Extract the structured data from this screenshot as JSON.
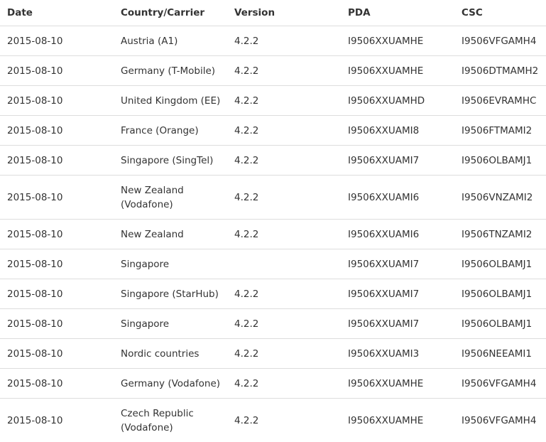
{
  "table": {
    "headers": {
      "date": "Date",
      "country": "Country/Carrier",
      "version": "Version",
      "pda": "PDA",
      "csc": "CSC"
    },
    "rows": [
      {
        "date": "2015-08-10",
        "country": "Austria (A1)",
        "version": "4.2.2",
        "pda": "I9506XXUAMHE",
        "csc": "I9506VFGAMH4"
      },
      {
        "date": "2015-08-10",
        "country": "Germany (T-Mobile)",
        "version": "4.2.2",
        "pda": "I9506XXUAMHE",
        "csc": "I9506DTMAMH2"
      },
      {
        "date": "2015-08-10",
        "country": "United Kingdom (EE)",
        "version": "4.2.2",
        "pda": "I9506XXUAMHD",
        "csc": "I9506EVRAMHC"
      },
      {
        "date": "2015-08-10",
        "country": "France (Orange)",
        "version": "4.2.2",
        "pda": "I9506XXUAMI8",
        "csc": "I9506FTMAMI2"
      },
      {
        "date": "2015-08-10",
        "country": "Singapore (SingTel)",
        "version": "4.2.2",
        "pda": "I9506XXUAMI7",
        "csc": "I9506OLBAMJ1"
      },
      {
        "date": "2015-08-10",
        "country": "New Zealand (Vodafone)",
        "version": "4.2.2",
        "pda": "I9506XXUAMI6",
        "csc": "I9506VNZAMI2"
      },
      {
        "date": "2015-08-10",
        "country": "New Zealand",
        "version": "4.2.2",
        "pda": "I9506XXUAMI6",
        "csc": "I9506TNZAMI2"
      },
      {
        "date": "2015-08-10",
        "country": "Singapore",
        "version": "",
        "pda": "I9506XXUAMI7",
        "csc": "I9506OLBAMJ1"
      },
      {
        "date": "2015-08-10",
        "country": "Singapore (StarHub)",
        "version": "4.2.2",
        "pda": "I9506XXUAMI7",
        "csc": "I9506OLBAMJ1"
      },
      {
        "date": "2015-08-10",
        "country": "Singapore",
        "version": "4.2.2",
        "pda": "I9506XXUAMI7",
        "csc": "I9506OLBAMJ1"
      },
      {
        "date": "2015-08-10",
        "country": "Nordic countries",
        "version": "4.2.2",
        "pda": "I9506XXUAMI3",
        "csc": "I9506NEEAMI1"
      },
      {
        "date": "2015-08-10",
        "country": "Germany (Vodafone)",
        "version": "4.2.2",
        "pda": "I9506XXUAMHE",
        "csc": "I9506VFGAMH4"
      },
      {
        "date": "2015-08-10",
        "country": "Czech Republic (Vodafone)",
        "version": "4.2.2",
        "pda": "I9506XXUAMHE",
        "csc": "I9506VFGAMH4"
      }
    ]
  }
}
